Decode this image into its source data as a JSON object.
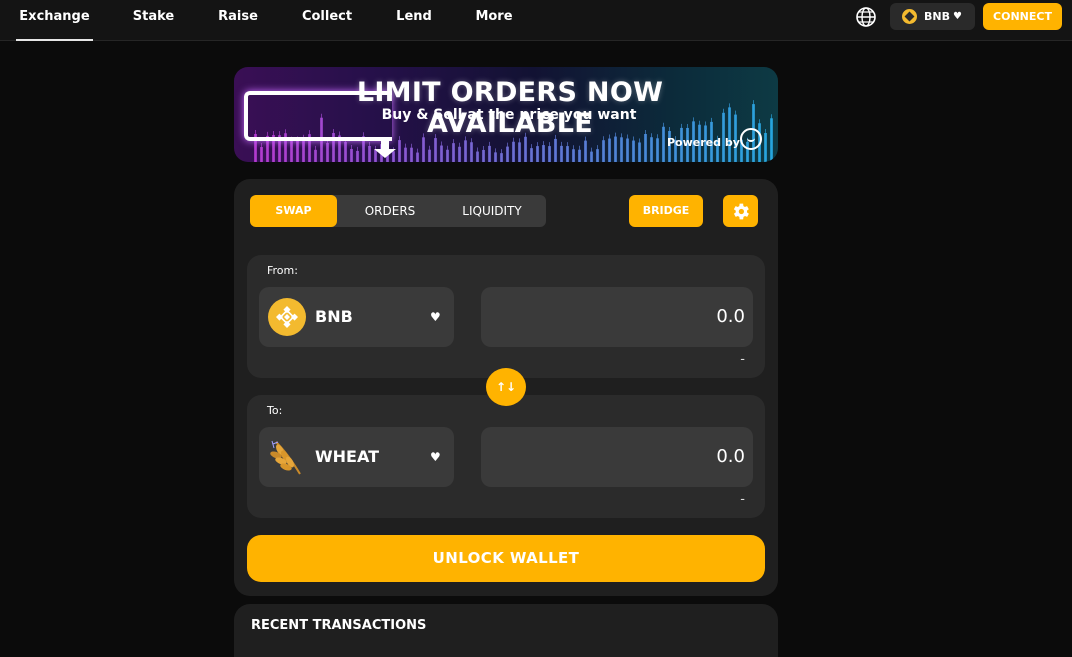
{
  "nav": {
    "items": [
      {
        "label": "Exchange",
        "active": true
      },
      {
        "label": "Stake"
      },
      {
        "label": "Raise"
      },
      {
        "label": "Collect"
      },
      {
        "label": "Lend"
      },
      {
        "label": "More"
      }
    ],
    "network_label": "BNB",
    "connect_label": "CONNECT"
  },
  "banner": {
    "headline": "LIMIT ORDERS NOW AVAILABLE",
    "subline": "Buy & Sell at the price you want",
    "powered_by": "Powered by",
    "logo_icon": "robot-logo-icon"
  },
  "swap": {
    "tabs": [
      {
        "label": "SWAP",
        "active": true
      },
      {
        "label": "ORDERS"
      },
      {
        "label": "LIQUIDITY"
      }
    ],
    "bridge_label": "BRIDGE",
    "from": {
      "label": "From:",
      "token": "BNB",
      "token_icon": "bnb-coin-icon",
      "amount": "0.0",
      "balance": "-"
    },
    "to": {
      "label": "To:",
      "token": "WHEAT",
      "token_icon": "wheat-icon",
      "amount": "0.0",
      "balance": "-"
    },
    "switch_label": "↑↓",
    "unlock_label": "UNLOCK WALLET"
  },
  "recent": {
    "title": "RECENT TRANSACTIONS"
  },
  "colors": {
    "accent": "#ffb300",
    "background": "#0b0b0b",
    "card": "#1f1f1f",
    "panel": "#2b2b2b",
    "field": "#3a3a3a",
    "bnb_yellow": "#f3ba2f"
  }
}
